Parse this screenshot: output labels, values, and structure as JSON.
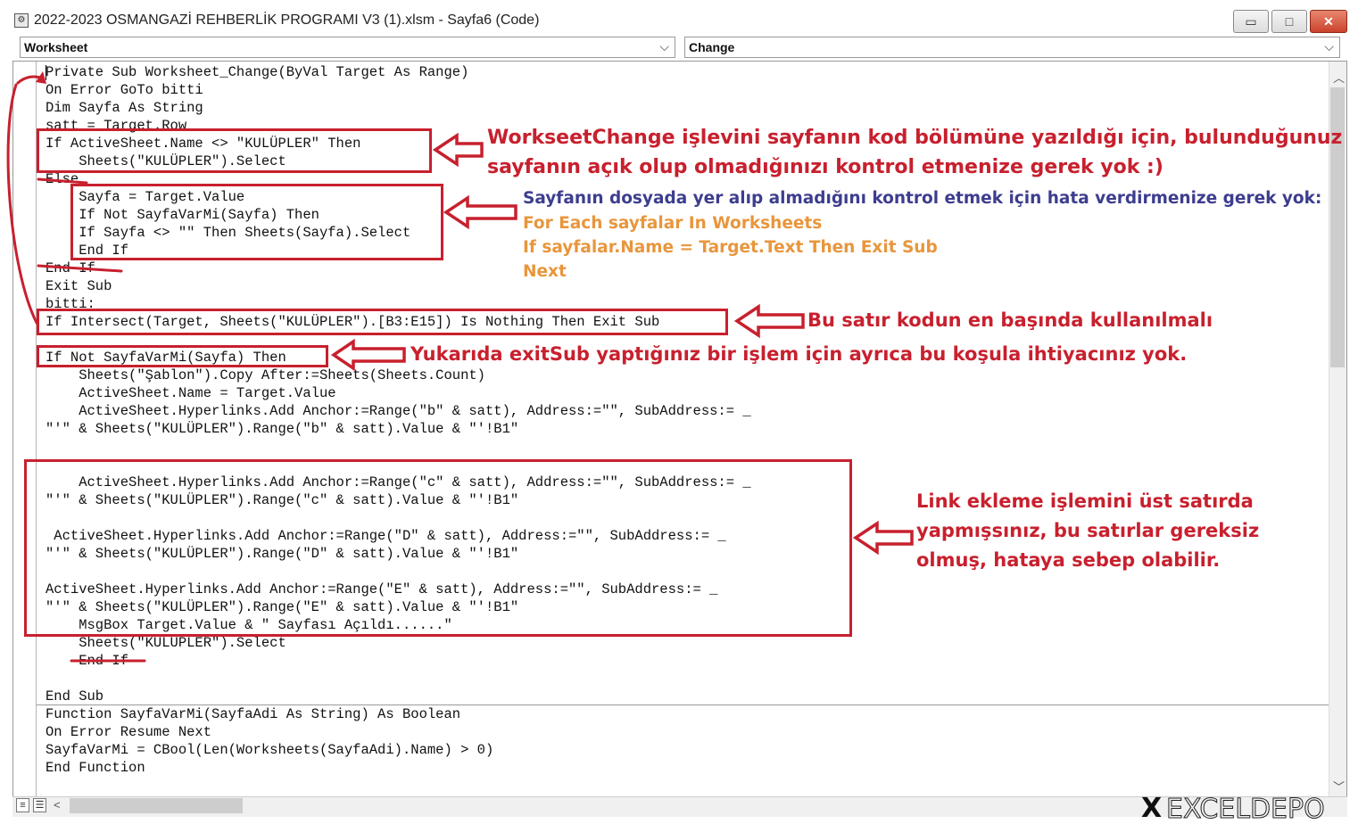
{
  "window": {
    "title": "2022-2023 OSMANGAZİ REHBERLİK PROGRAMI V3 (1).xlsm - Sayfa6 (Code)",
    "minimize_glyph": "▭",
    "maximize_glyph": "□",
    "close_glyph": "✕"
  },
  "object_combo": {
    "value": "Worksheet"
  },
  "procedure_combo": {
    "value": "Change"
  },
  "code_lines": [
    "Private Sub Worksheet_Change(ByVal Target As Range)",
    "On Error GoTo bitti",
    "Dim Sayfa As String",
    "satt = Target.Row",
    "If ActiveSheet.Name <> \"KULÜPLER\" Then",
    "    Sheets(\"KULÜPLER\").Select",
    "Else",
    "    Sayfa = Target.Value",
    "    If Not SayfaVarMi(Sayfa) Then",
    "    If Sayfa <> \"\" Then Sheets(Sayfa).Select",
    "    End If",
    "End If",
    "Exit Sub",
    "bitti:",
    "If Intersect(Target, Sheets(\"KULÜPLER\").[B3:E15]) Is Nothing Then Exit Sub",
    "",
    "If Not SayfaVarMi(Sayfa) Then",
    "    Sheets(\"Şablon\").Copy After:=Sheets(Sheets.Count)",
    "    ActiveSheet.Name = Target.Value",
    "    ActiveSheet.Hyperlinks.Add Anchor:=Range(\"b\" & satt), Address:=\"\", SubAddress:= _",
    "\"'\" & Sheets(\"KULÜPLER\").Range(\"b\" & satt).Value & \"'!B1\"",
    "",
    "",
    "    ActiveSheet.Hyperlinks.Add Anchor:=Range(\"c\" & satt), Address:=\"\", SubAddress:= _",
    "\"'\" & Sheets(\"KULÜPLER\").Range(\"c\" & satt).Value & \"'!B1\"",
    "",
    " ActiveSheet.Hyperlinks.Add Anchor:=Range(\"D\" & satt), Address:=\"\", SubAddress:= _",
    "\"'\" & Sheets(\"KULÜPLER\").Range(\"D\" & satt).Value & \"'!B1\"",
    "",
    "ActiveSheet.Hyperlinks.Add Anchor:=Range(\"E\" & satt), Address:=\"\", SubAddress:= _",
    "\"'\" & Sheets(\"KULÜPLER\").Range(\"E\" & satt).Value & \"'!B1\"",
    "    MsgBox Target.Value & \" Sayfası Açıldı......\"",
    "    Sheets(\"KULÜPLER\").Select",
    "    End If",
    "",
    "End Sub",
    "Function SayfaVarMi(SayfaAdi As String) As Boolean",
    "On Error Resume Next",
    "SayfaVarMi = CBool(Len(Worksheets(SayfaAdi).Name) > 0)",
    "End Function"
  ],
  "annotations": {
    "note1_line1": "WorkseetChange işlevini sayfanın kod bölümüne yazıldığı için, bulunduğunuz",
    "note1_line2": "sayfanın açık olup olmadığınızı kontrol etmenize gerek yok :)",
    "note2_line1": "Sayfanın dosyada yer alıp almadığını kontrol etmek için hata verdirmenize gerek yok:",
    "note2_code1": "For Each sayfalar In Worksheets",
    "note2_code2": "If sayfalar.Name = Target.Text Then Exit Sub",
    "note2_code3": "Next",
    "note3": "Bu satır kodun en başında kullanılmalı",
    "note4": "Yukarıda exitSub yaptığınız bir işlem için ayrıca bu koşula ihtiyacınız yok.",
    "note5_line1": "Link ekleme işlemini üst satırda",
    "note5_line2": "yapmışsınız, bu satırlar gereksiz",
    "note5_line3": "olmuş, hataya sebep olabilir."
  },
  "watermark": {
    "text": "EXCELDEPO"
  },
  "colors": {
    "annotation_red": "#c8202e",
    "annotation_navy": "#3d3d8f",
    "annotation_orange": "#e8963c"
  }
}
